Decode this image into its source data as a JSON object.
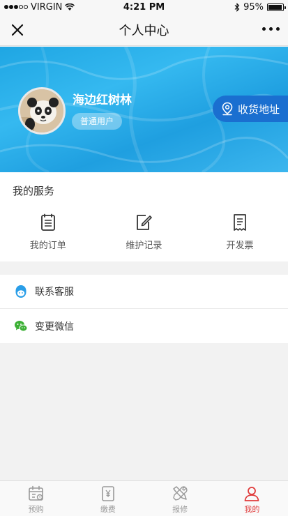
{
  "status_bar": {
    "carrier": "VIRGIN",
    "time": "4:21 PM",
    "battery": "95%",
    "battery_level": 0.95
  },
  "nav": {
    "title": "个人中心",
    "close_icon": "close-icon",
    "more_icon": "more-dots-icon"
  },
  "profile": {
    "name": "海边红树林",
    "badge": "普通用户",
    "address_button": "收货地址",
    "address_icon": "location-pin-icon",
    "banner_color": "#1fa6e3"
  },
  "services": {
    "title": "我的服务",
    "items": [
      {
        "label": "我的订单",
        "icon": "order-list-icon"
      },
      {
        "label": "维护记录",
        "icon": "edit-record-icon"
      },
      {
        "label": "开发票",
        "icon": "invoice-icon"
      }
    ]
  },
  "menu": {
    "items": [
      {
        "label": "联系客服",
        "icon": "customer-service-icon",
        "color": "#2a9ee8"
      },
      {
        "label": "变更微信",
        "icon": "wechat-icon",
        "color": "#3cb035"
      }
    ]
  },
  "tabs": {
    "active_color": "#e03b3b",
    "inactive_color": "#999999",
    "items": [
      {
        "label": "预购",
        "icon": "calendar-icon"
      },
      {
        "label": "缴费",
        "icon": "payment-icon"
      },
      {
        "label": "报修",
        "icon": "repair-tools-icon"
      },
      {
        "label": "我的",
        "icon": "user-icon",
        "active": true
      }
    ]
  }
}
